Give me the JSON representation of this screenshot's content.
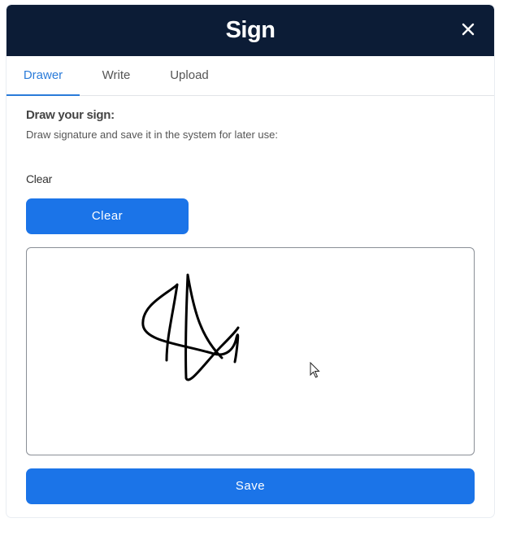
{
  "dialog": {
    "title": "Sign",
    "close_icon": "close-icon"
  },
  "tabs": [
    {
      "label": "Drawer",
      "active": true
    },
    {
      "label": "Write",
      "active": false
    },
    {
      "label": "Upload",
      "active": false
    }
  ],
  "drawer": {
    "heading": "Draw your sign:",
    "description": "Draw signature and save it in the system for later use:",
    "clear_label": "Clear",
    "clear_button": "Clear",
    "save_button": "Save"
  },
  "colors": {
    "header_bg": "#0c1c36",
    "accent": "#1b74e8",
    "tab_active": "#2a7bd9"
  },
  "icons": {
    "pointer": "mouse-pointer-icon"
  }
}
